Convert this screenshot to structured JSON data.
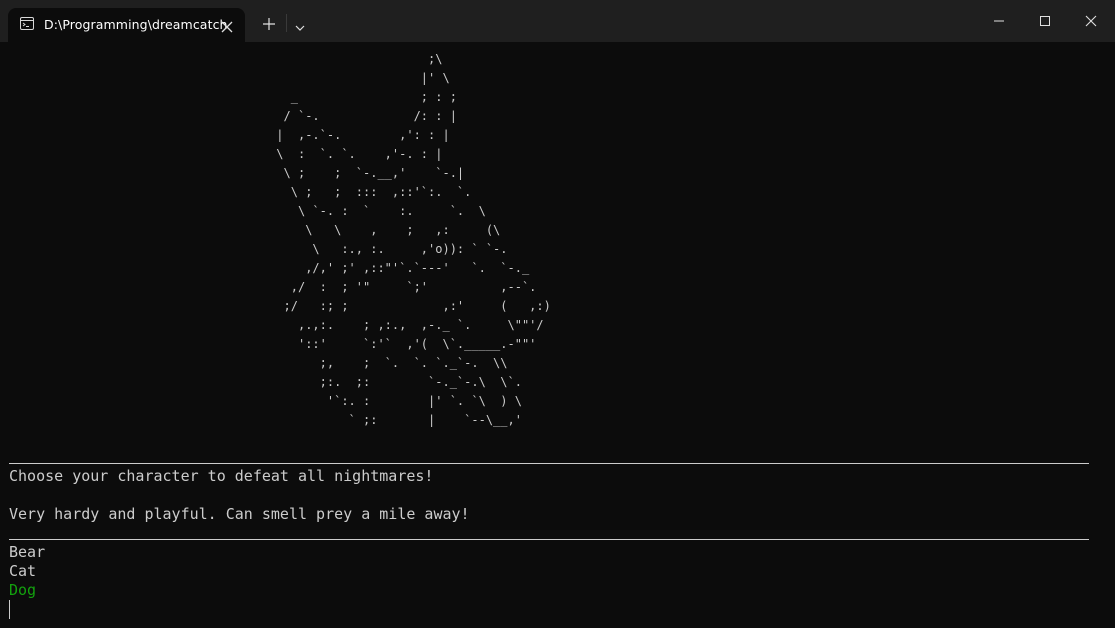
{
  "window": {
    "tab_title": "D:\\Programming\\dreamcatch",
    "tab_icon": "terminal-icon",
    "accent_color": "#13a10e",
    "background_color": "#0c0c0c",
    "titlebar_color": "#1f1f1f"
  },
  "terminal": {
    "art": "                                                          ;\\\n                                                         |' \\\n                                       _                 ; : ;\n                                      / `-.             /: : |\n                                     |  ,-.`-.        ,': : |\n                                     \\  :  `. `.    ,'-. : |\n                                      \\ ;    ;  `-.__,'    `-.|\n                                       \\ ;   ;  :::  ,::'`:.  `.\n                                        \\ `-. :  `    :.     `.  \\\n                                         \\   \\    ,    ;   ,:     (\\\n                                          \\   :., :.     ,'o)): ` `-.\n                                         ,/,' ;' ,::\"'`.`---'   `.  `-._\n                                       ,/  :  ; '\"     `;'          ,--`.\n                                      ;/   :; ;             ,:'     (   ,:)\n                                        ,.,:.    ; ,:.,  ,-._ `.     \\\"\"'/\n                                        '::'     `:'`  ,'(  \\`._____.-\"\"'\n                                           ;,    ;  `.  `. `._`-.  \\\\\n                                           ;:.  ;:        `-._`-.\\  \\`.\n                                            '`:. :        |' `. `\\  ) \\\n                                               ` ;:       |    `--\\__,'",
    "title": "Choose your character to defeat all nightmares!",
    "description": "Very hardy and playful. Can smell prey a mile away!",
    "options": [
      "Bear",
      "Cat",
      "Dog"
    ],
    "selected_option": "Dog"
  }
}
